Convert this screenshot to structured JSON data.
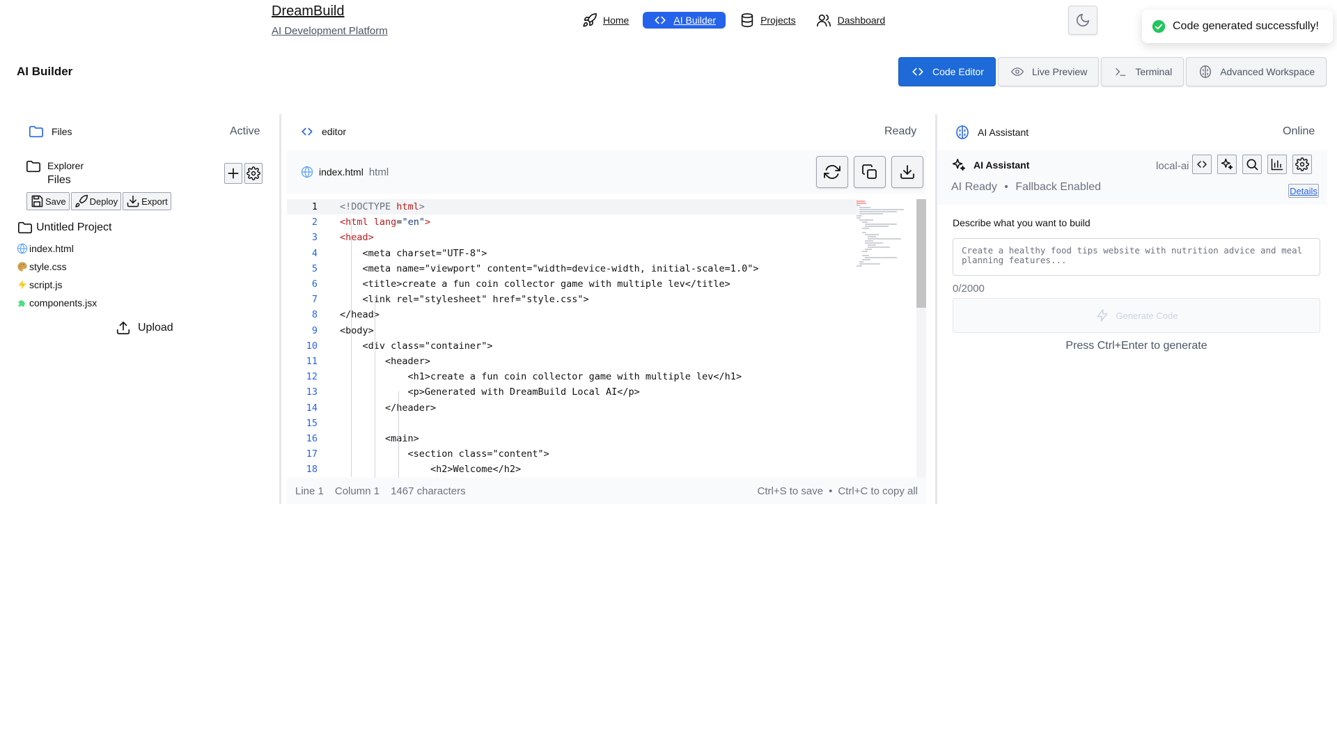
{
  "brand": {
    "name": "DreamBuild",
    "subtitle": "AI Development Platform"
  },
  "nav": [
    {
      "label": "Home",
      "icon": "rocket-icon",
      "active": false
    },
    {
      "label": "AI Builder",
      "icon": "code-icon",
      "active": true
    },
    {
      "label": "Projects",
      "icon": "database-icon",
      "active": false
    },
    {
      "label": "Dashboard",
      "icon": "users-icon",
      "active": false
    }
  ],
  "toast": {
    "message": "Code generated successfully!",
    "icon": "check-circle-icon",
    "color": "#22c55e"
  },
  "page": {
    "title": "AI Builder"
  },
  "tabs": [
    {
      "label": "Code Editor",
      "icon": "code-icon",
      "active": true
    },
    {
      "label": "Live Preview",
      "icon": "eye-icon",
      "active": false
    },
    {
      "label": "Terminal",
      "icon": "terminal-icon",
      "active": false
    },
    {
      "label": "Advanced Workspace",
      "icon": "brain-icon",
      "active": false
    }
  ],
  "files_panel": {
    "title": "Files",
    "status": "Active",
    "explorer_label": "Explorer",
    "explorer_files": "Files",
    "actions": [
      {
        "label": "Save"
      },
      {
        "label": "Deploy"
      },
      {
        "label": "Export"
      }
    ],
    "project_name": "Untitled Project",
    "files": [
      {
        "name": "index.html",
        "icon": "globe-icon"
      },
      {
        "name": "style.css",
        "icon": "palette-icon"
      },
      {
        "name": "script.js",
        "icon": "lightning-icon"
      },
      {
        "name": "components.jsx",
        "icon": "puzzle-icon"
      }
    ],
    "upload_label": "Upload"
  },
  "editor": {
    "title": "editor",
    "status": "Ready",
    "file_name": "index.html",
    "file_type": "html",
    "lines": [
      "<!DOCTYPE html>",
      "<html lang=\"en\">",
      "<head>",
      "    <meta charset=\"UTF-8\">",
      "    <meta name=\"viewport\" content=\"width=device-width, initial-scale=1.0\">",
      "    <title>create a fun coin collector game with multiple lev</title>",
      "    <link rel=\"stylesheet\" href=\"style.css\">",
      "</head>",
      "<body>",
      "    <div class=\"container\">",
      "        <header>",
      "            <h1>create a fun coin collector game with multiple lev</h1>",
      "            <p>Generated with DreamBuild Local AI</p>",
      "        </header>",
      "",
      "        <main>",
      "            <section class=\"content\">",
      "                <h2>Welcome</h2>"
    ],
    "status_line": "Line 1",
    "status_col": "Column 1",
    "status_chars": "1467 characters",
    "shortcut_save": "Ctrl+S to save",
    "shortcut_copy": "Ctrl+C to copy all"
  },
  "assistant": {
    "panel_title": "AI Assistant",
    "panel_status": "Online",
    "card_title": "AI Assistant",
    "model": "local-ai",
    "status_ready": "AI Ready",
    "status_fallback": "Fallback Enabled",
    "details_label": "Details",
    "prompt_label": "Describe what you want to build",
    "prompt_placeholder": "Create a healthy food tips website with nutrition advice and meal planning features...",
    "char_count": "0/2000",
    "generate_label": "Generate Code",
    "hint": "Press Ctrl+Enter to generate"
  }
}
